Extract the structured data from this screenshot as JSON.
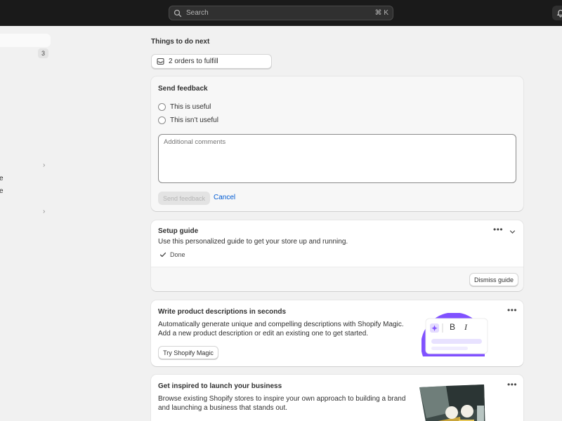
{
  "topbar": {
    "search_placeholder": "Search",
    "shortcut": "⌘ K"
  },
  "sidebar": {
    "badge_count": "3",
    "fragments": [
      "e",
      "e"
    ]
  },
  "main": {
    "heading": "Things to do next",
    "orders_button": "2 orders to fulfill"
  },
  "feedback": {
    "title": "Send feedback",
    "option_useful": "This is useful",
    "option_not_useful": "This isn’t useful",
    "comments_placeholder": "Additional comments",
    "send_label": "Send feedback",
    "cancel_label": "Cancel"
  },
  "setup_guide": {
    "title": "Setup guide",
    "description": "Use this personalized guide to get your store up and running.",
    "done_label": "Done",
    "dismiss_label": "Dismiss guide"
  },
  "magic_card": {
    "title": "Write product descriptions in seconds",
    "line1": "Automatically generate unique and compelling descriptions with Shopify Magic.",
    "line2": "Add a new product description or edit an existing one to get started.",
    "button_label": "Try Shopify Magic",
    "bold_glyph": "B",
    "italic_glyph": "I"
  },
  "inspire_card": {
    "title": "Get inspired to launch your business",
    "line1": "Browse existing Shopify stores to inspire your own approach to building a brand",
    "line2": "and launching a business that stands out."
  },
  "colors": {
    "topbar": "#1a1a1a",
    "link": "#005bd3",
    "magic_purple": "#8051ff"
  }
}
